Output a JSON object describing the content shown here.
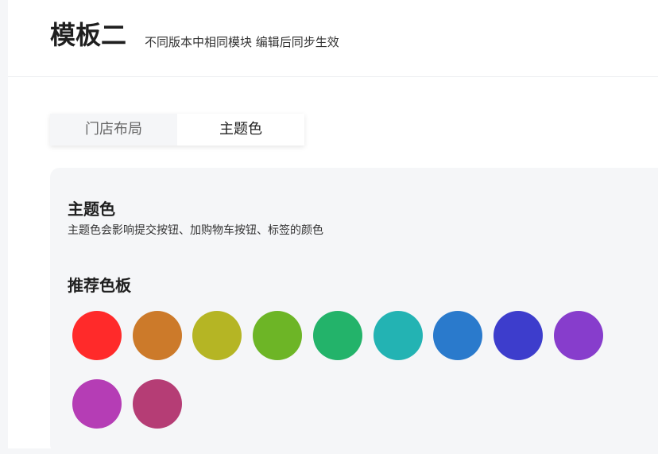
{
  "header": {
    "title": "模板二",
    "subtitle": "不同版本中相同模块 编辑后同步生效"
  },
  "tabs": [
    {
      "label": "门店布局",
      "active": false
    },
    {
      "label": "主题色",
      "active": true
    }
  ],
  "theme": {
    "title": "主题色",
    "description": "主题色会影响提交按钮、加购物车按钮、标签的颜色"
  },
  "palette": {
    "title": "推荐色板",
    "colors": [
      "#ff2a2a",
      "#cc7a2a",
      "#b5b524",
      "#6db526",
      "#23b36a",
      "#23b3b3",
      "#2a7acc",
      "#3d3dcc",
      "#873dcc",
      "#b53db5",
      "#b53d75"
    ]
  }
}
